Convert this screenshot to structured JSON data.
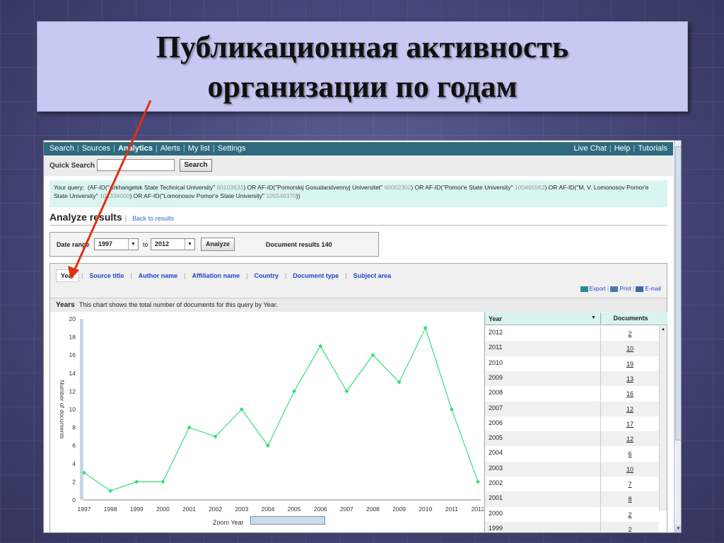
{
  "slide": {
    "title_line1": "Публикационная активность",
    "title_line2": "организации по годам",
    "arrow_color": "#e03010"
  },
  "nav": {
    "left_items": [
      "Search",
      "Sources",
      "Analytics",
      "Alerts",
      "My list",
      "Settings"
    ],
    "right_items": [
      "Live Chat",
      "Help",
      "Tutorials"
    ],
    "active": "Analytics"
  },
  "quick_search": {
    "label": "Quick Search",
    "value": "",
    "button": "Search"
  },
  "query": {
    "prefix": "Your query:",
    "p1": "(AF-ID(\"Arkhangelsk State Technical University\"",
    "id1": "60103631",
    "p2": ") OR AF-ID(\"Pomorskij Gosudarstvennyj Universitet\"",
    "id2": "60002302",
    "p3": ") OR AF-ID(\"Pomor'e State University\"",
    "id3": "100465562",
    "p4": ") OR AF-ID(\"M. V. Lomonosov Pomor'e State University\"",
    "id4": "101334000",
    "p5": ") OR AF-ID(\"Lomonosov Pomor'e State University\"",
    "id5": "105546370",
    "p6": "))"
  },
  "analyze": {
    "heading": "Analyze results",
    "back_link": "Back to results"
  },
  "date_range": {
    "label": "Date range",
    "from": "1997",
    "to_label": "to",
    "to": "2012",
    "button": "Analyze",
    "results": "Document results 140"
  },
  "tabs": [
    "Year",
    "Source title",
    "Author name",
    "Affiliation name",
    "Country",
    "Document type",
    "Subject area"
  ],
  "active_tab": "Year",
  "exports": {
    "export": "Export",
    "print": "Print",
    "email": "E-mail"
  },
  "years_bar": {
    "title": "Years",
    "desc": "This chart shows the total number of documents for this query by Year."
  },
  "zoom_label": "Zoom Year",
  "table": {
    "col_year": "Year",
    "col_docs": "Documents",
    "rows": [
      {
        "year": "2012",
        "docs": "2"
      },
      {
        "year": "2011",
        "docs": "10"
      },
      {
        "year": "2010",
        "docs": "19"
      },
      {
        "year": "2009",
        "docs": "13"
      },
      {
        "year": "2008",
        "docs": "16"
      },
      {
        "year": "2007",
        "docs": "12"
      },
      {
        "year": "2006",
        "docs": "17"
      },
      {
        "year": "2005",
        "docs": "12"
      },
      {
        "year": "2004",
        "docs": "6"
      },
      {
        "year": "2003",
        "docs": "10"
      },
      {
        "year": "2002",
        "docs": "7"
      },
      {
        "year": "2001",
        "docs": "8"
      },
      {
        "year": "2000",
        "docs": "2"
      },
      {
        "year": "1999",
        "docs": "2"
      }
    ]
  },
  "chart_data": {
    "type": "line",
    "x": [
      1997,
      1998,
      1999,
      2000,
      2001,
      2002,
      2003,
      2004,
      2005,
      2006,
      2007,
      2008,
      2009,
      2010,
      2011,
      2012
    ],
    "series": [
      {
        "values": [
          3,
          1,
          2,
          2,
          8,
          7,
          10,
          6,
          12,
          17,
          12,
          16,
          13,
          19,
          10,
          2
        ]
      }
    ],
    "ylabel": "Number of documents",
    "ylim": [
      0,
      20
    ],
    "yticks": [
      0,
      2,
      4,
      6,
      8,
      10,
      12,
      14,
      16,
      18,
      20
    ],
    "color": "#33e07a",
    "grid": false
  }
}
